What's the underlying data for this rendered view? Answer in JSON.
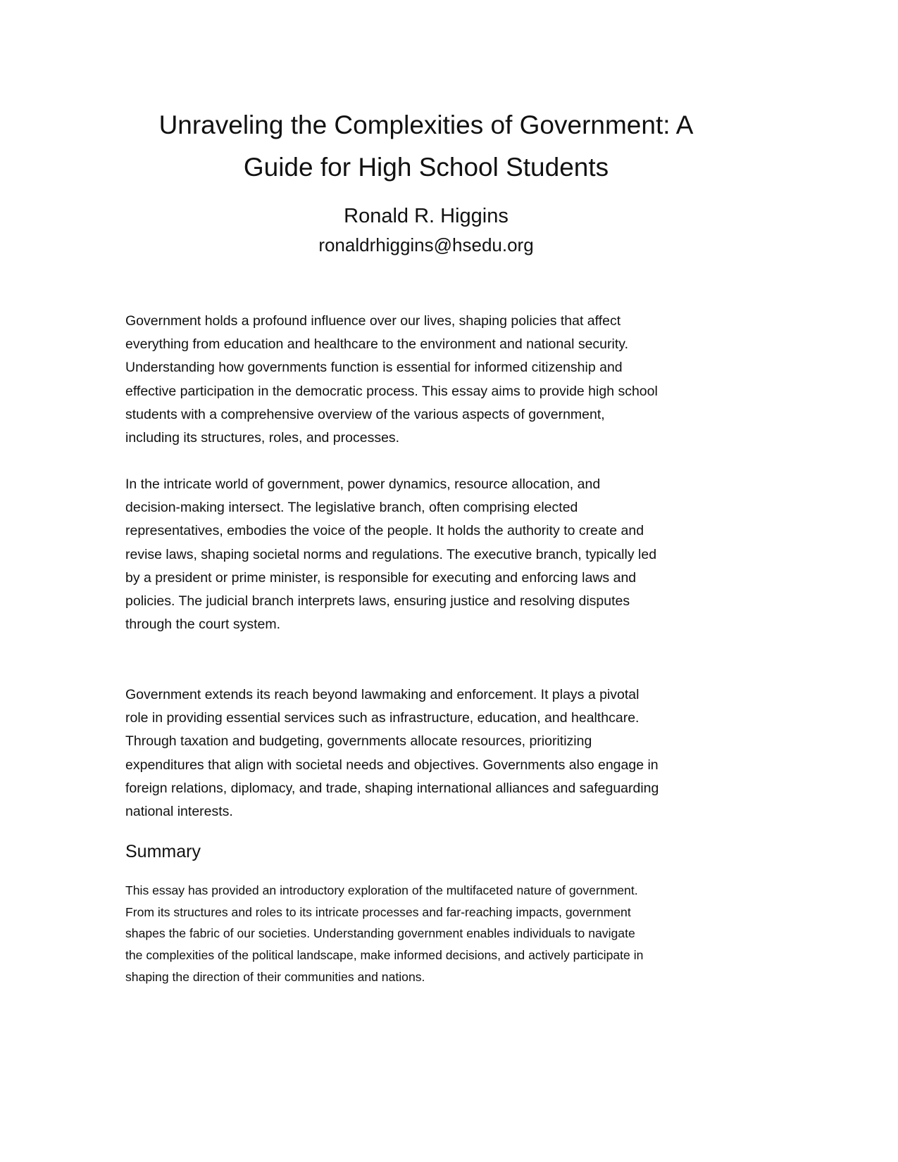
{
  "document": {
    "title_lines": [
      "Unraveling the Complexities of Government: A",
      "Guide for High School Students"
    ],
    "author": "Ronald R. Higgins",
    "email": "ronaldrhiggins@hsedu.org",
    "paragraphs": [
      [
        "Government holds a profound influence over our lives, shaping policies that affect",
        "everything from education and healthcare to the environment and national security.",
        "Understanding how governments function is essential for informed citizenship and",
        "effective participation in the democratic process. This essay aims to provide high school",
        "students with a comprehensive overview of the various aspects of government,",
        "including its structures, roles, and processes."
      ],
      [
        "In the intricate world of government, power dynamics, resource allocation, and",
        "decision-making intersect. The legislative branch, often comprising elected",
        "representatives, embodies the voice of the people. It holds the authority to create and",
        "revise laws, shaping societal norms and regulations. The executive branch, typically led",
        "by a president or prime minister, is responsible for executing and enforcing laws and",
        "policies. The judicial branch interprets laws, ensuring justice and resolving disputes",
        "through the court system."
      ],
      [
        "Government extends its reach beyond lawmaking and enforcement. It plays a pivotal",
        "role in providing essential services such as infrastructure, education, and healthcare.",
        "Through taxation and budgeting, governments allocate resources, prioritizing",
        "expenditures that align with societal needs and objectives. Governments also engage in",
        "foreign relations, diplomacy, and trade, shaping international alliances and safeguarding",
        "national interests."
      ]
    ],
    "summary_heading": "Summary",
    "summary_lines": [
      "This essay has provided an introductory exploration of the multifaceted nature of government.",
      "From its structures and roles to its intricate processes and far-reaching impacts, government",
      "shapes the fabric of our societies. Understanding government enables individuals to navigate",
      "the complexities of the political landscape, make informed decisions, and actively participate in",
      "shaping the direction of their communities and nations."
    ]
  }
}
